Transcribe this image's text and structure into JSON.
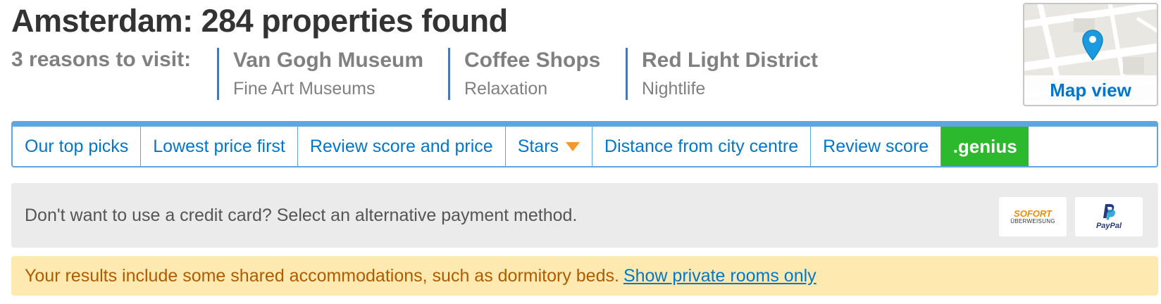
{
  "header": {
    "title": "Amsterdam: 284 properties found"
  },
  "reasons": {
    "label": "3 reasons to visit:",
    "items": [
      {
        "title": "Van Gogh Museum",
        "subtitle": "Fine Art Museums"
      },
      {
        "title": "Coffee Shops",
        "subtitle": "Relaxation"
      },
      {
        "title": "Red Light District",
        "subtitle": "Nightlife"
      }
    ]
  },
  "map": {
    "label": "Map view",
    "icon": "map-pin-icon"
  },
  "sort": {
    "items": [
      {
        "label": "Our top picks"
      },
      {
        "label": "Lowest price first"
      },
      {
        "label": "Review score and price"
      },
      {
        "label": "Stars"
      },
      {
        "label": "Distance from city centre"
      },
      {
        "label": "Review score"
      }
    ],
    "genius_label": ".genius"
  },
  "payment": {
    "text": "Don't want to use a credit card? Select an alternative payment method.",
    "sofort_line1": "SOFORT",
    "sofort_line2": "ÜBERWEISUNG",
    "paypal_label": "PayPal"
  },
  "notice": {
    "text": "Your results include some shared accommodations, such as dormitory beds.",
    "link": "Show private rooms only"
  },
  "colors": {
    "link_blue": "#0077cc",
    "sort_border": "#5ea6df",
    "genius_green": "#2db92d",
    "stars_arrow": "#f7962c",
    "reason_divider": "#4a77b4",
    "notice_bg": "#feeab0",
    "notice_text": "#b15a00"
  }
}
